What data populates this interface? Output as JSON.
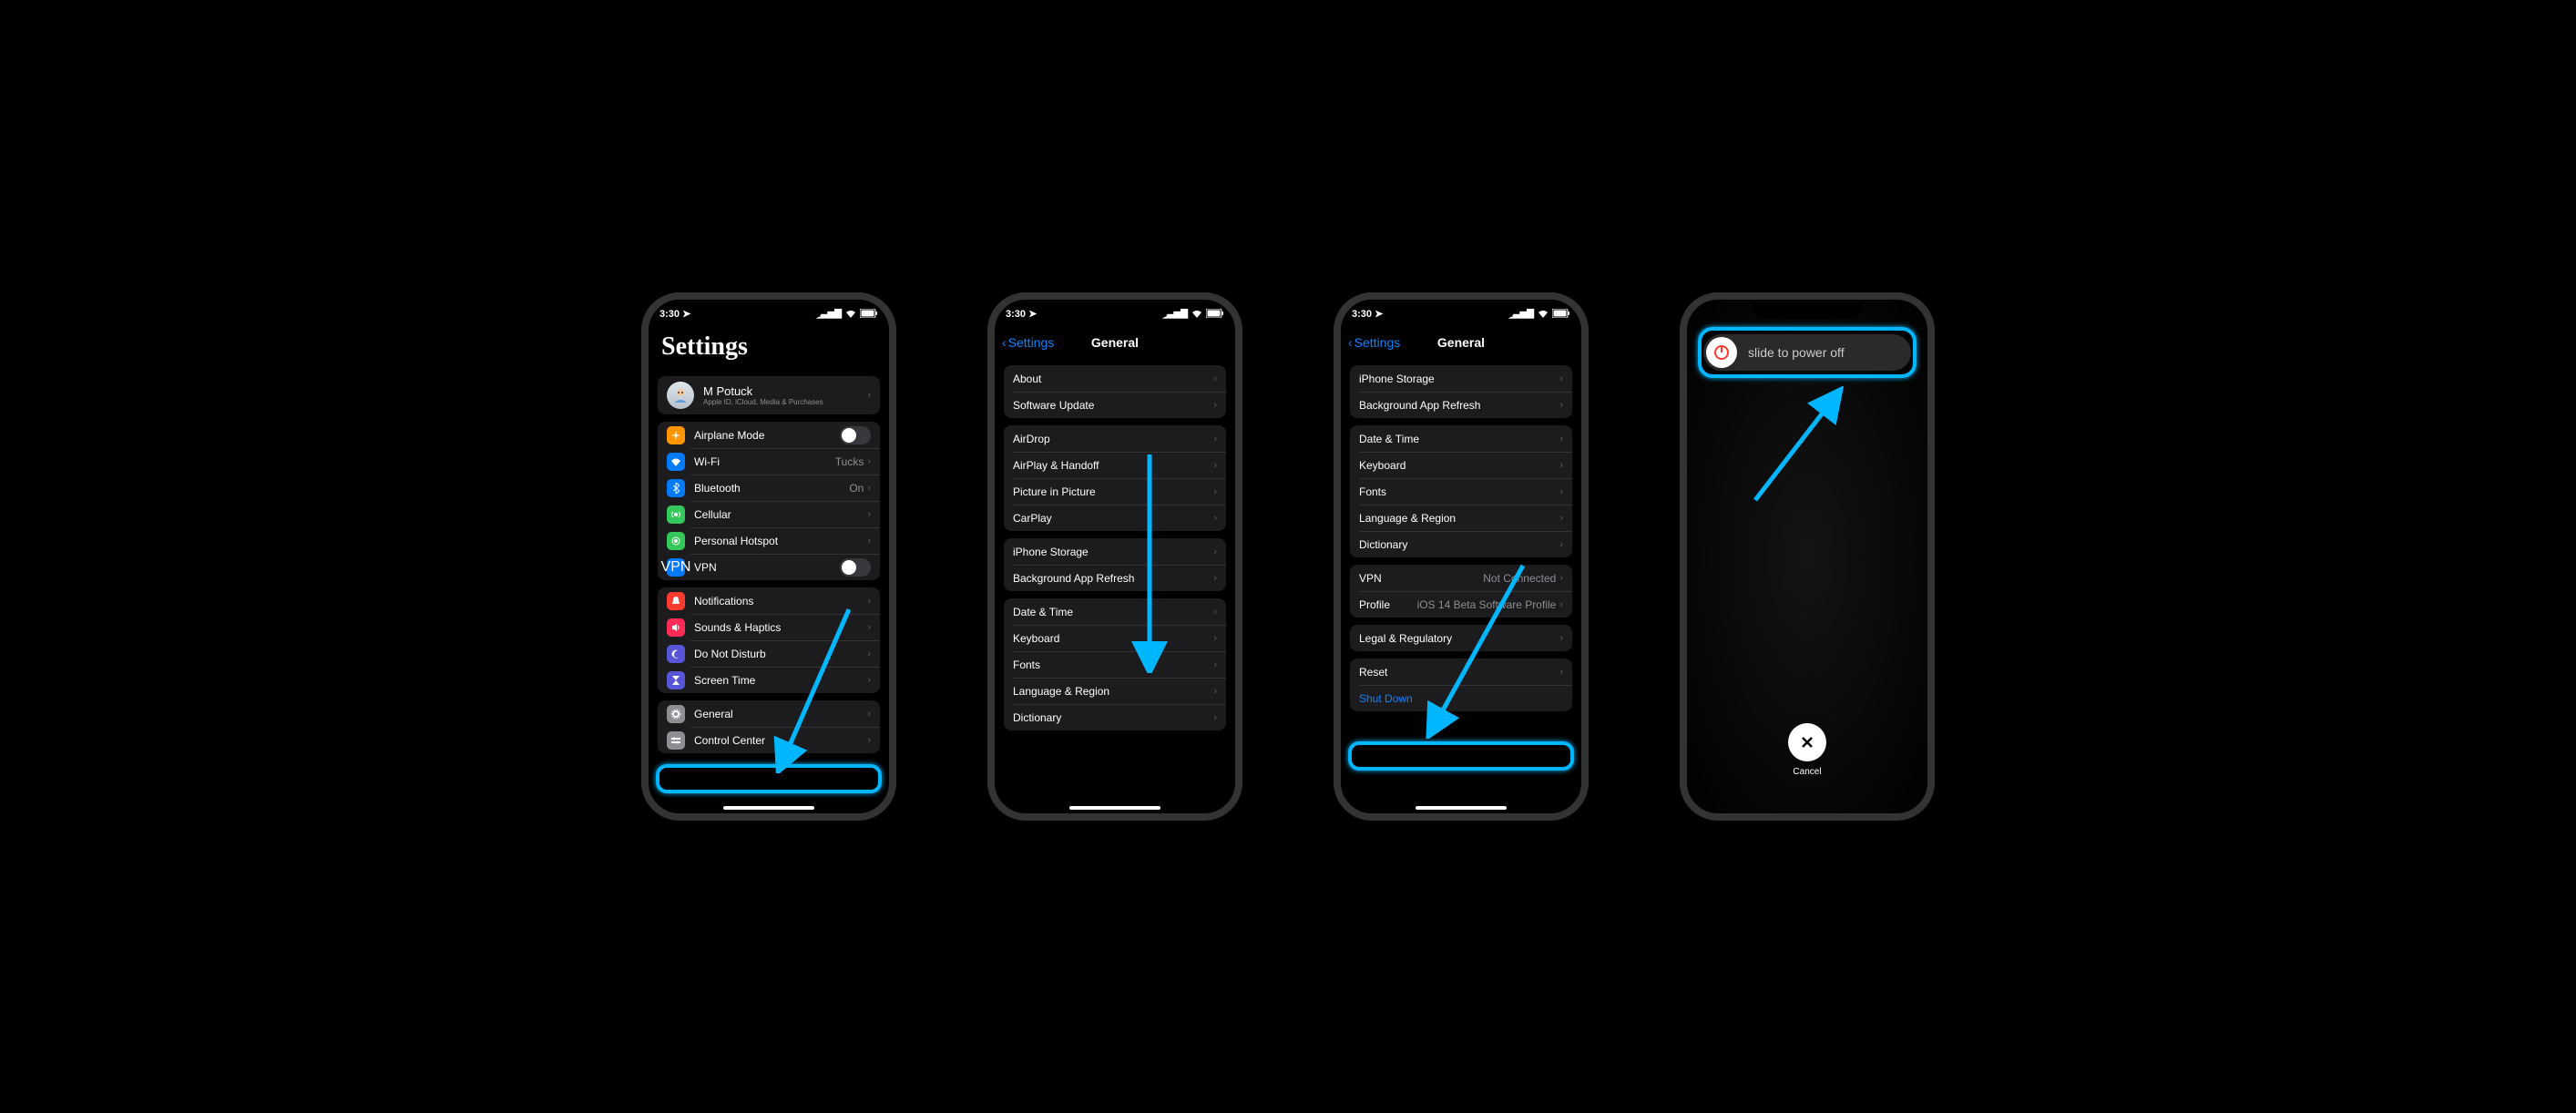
{
  "status": {
    "time": "3:30",
    "loc_icon": "➤"
  },
  "phone1": {
    "title": "Settings",
    "profile": {
      "name": "M Potuck",
      "subtitle": "Apple ID, iCloud, Media & Purchases"
    },
    "g1": [
      {
        "icon": "airplane",
        "color": "#ff9500",
        "label": "Airplane Mode",
        "kind": "toggle"
      },
      {
        "icon": "wifi",
        "color": "#007aff",
        "label": "Wi-Fi",
        "value": "Tucks"
      },
      {
        "icon": "bt",
        "color": "#007aff",
        "label": "Bluetooth",
        "value": "On"
      },
      {
        "icon": "cell",
        "color": "#34c759",
        "label": "Cellular"
      },
      {
        "icon": "hotspot",
        "color": "#34c759",
        "label": "Personal Hotspot"
      },
      {
        "icon": "vpn",
        "color": "#007aff",
        "label": "VPN",
        "kind": "toggle"
      }
    ],
    "g2": [
      {
        "icon": "bell",
        "color": "#ff3b30",
        "label": "Notifications"
      },
      {
        "icon": "sound",
        "color": "#ff2d55",
        "label": "Sounds & Haptics"
      },
      {
        "icon": "moon",
        "color": "#5856d6",
        "label": "Do Not Disturb"
      },
      {
        "icon": "hourglass",
        "color": "#5856d6",
        "label": "Screen Time"
      }
    ],
    "g3": [
      {
        "icon": "gear",
        "color": "#8e8e93",
        "label": "General"
      },
      {
        "icon": "cc",
        "color": "#8e8e93",
        "label": "Control Center"
      }
    ]
  },
  "phone2": {
    "back": "Settings",
    "title": "General",
    "groups": [
      [
        "About",
        "Software Update"
      ],
      [
        "AirDrop",
        "AirPlay & Handoff",
        "Picture in Picture",
        "CarPlay"
      ],
      [
        "iPhone Storage",
        "Background App Refresh"
      ],
      [
        "Date & Time",
        "Keyboard",
        "Fonts",
        "Language & Region",
        "Dictionary"
      ]
    ]
  },
  "phone3": {
    "back": "Settings",
    "title": "General",
    "groups": [
      [
        "iPhone Storage",
        "Background App Refresh"
      ],
      [
        "Date & Time",
        "Keyboard",
        "Fonts",
        "Language & Region",
        "Dictionary"
      ],
      [
        {
          "label": "VPN",
          "value": "Not Connected"
        },
        {
          "label": "Profile",
          "value": "iOS 14 Beta Software Profile"
        }
      ],
      [
        "Legal & Regulatory"
      ],
      [
        "Reset",
        {
          "label": "Shut Down",
          "link": true
        }
      ]
    ]
  },
  "phone4": {
    "slide": "slide to power off",
    "cancel": "Cancel"
  },
  "annot": {
    "highlight_color": "#00b7ff"
  }
}
